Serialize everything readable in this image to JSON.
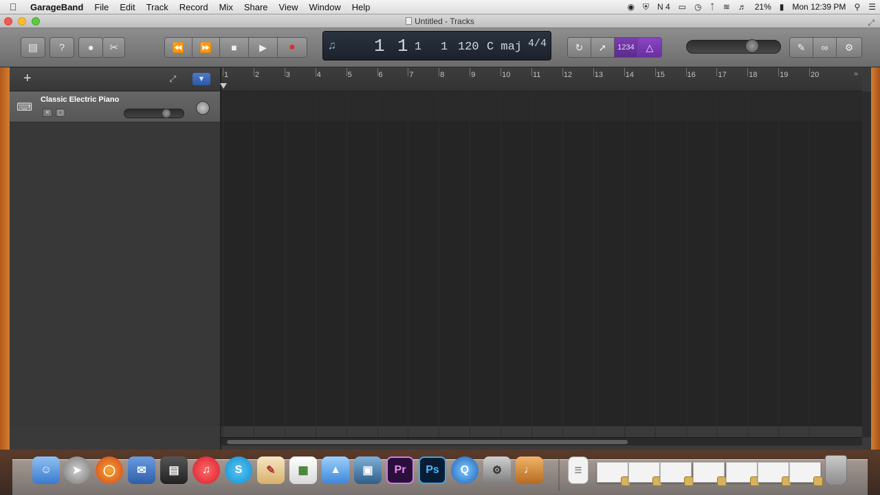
{
  "menubar": {
    "app_name": "GarageBand",
    "items": [
      "File",
      "Edit",
      "Track",
      "Record",
      "Mix",
      "Share",
      "View",
      "Window",
      "Help"
    ],
    "status": {
      "battery": "21%",
      "clock": "Mon 12:39 PM",
      "notification_count": "4"
    }
  },
  "window": {
    "title": "Untitled - Tracks"
  },
  "lcd": {
    "bar": "1",
    "beat": "1",
    "division": "1",
    "tick": "1",
    "tempo": "120",
    "key": "C maj",
    "time_signature": "4/4"
  },
  "toolbar": {
    "count_in_label": "1234"
  },
  "ruler": {
    "bars": [
      "1",
      "2",
      "3",
      "4",
      "5",
      "6",
      "7",
      "8",
      "9",
      "10",
      "11",
      "12",
      "13",
      "14",
      "15",
      "16",
      "17",
      "18",
      "19",
      "20"
    ]
  },
  "tracks": [
    {
      "name": "Classic Electric Piano"
    }
  ],
  "colors": {
    "count_in_active": "#6b34a0",
    "record": "#e32a2a",
    "filter_active": "#3a68b8",
    "wallpaper": "#c8782f"
  },
  "icons": {
    "library": "library-icon",
    "help": "help-icon",
    "smart_controls": "smart-controls-icon",
    "editors": "scissors-icon",
    "rewind": "rewind-icon",
    "fast_forward": "fast-forward-icon",
    "stop": "stop-icon",
    "play": "play-icon",
    "record": "record-icon",
    "cycle": "cycle-icon",
    "tuner": "tuner-icon",
    "metronome": "metronome-icon",
    "notepad": "notepad-icon",
    "loop_browser": "loop-icon",
    "media_browser": "media-browser-icon"
  }
}
